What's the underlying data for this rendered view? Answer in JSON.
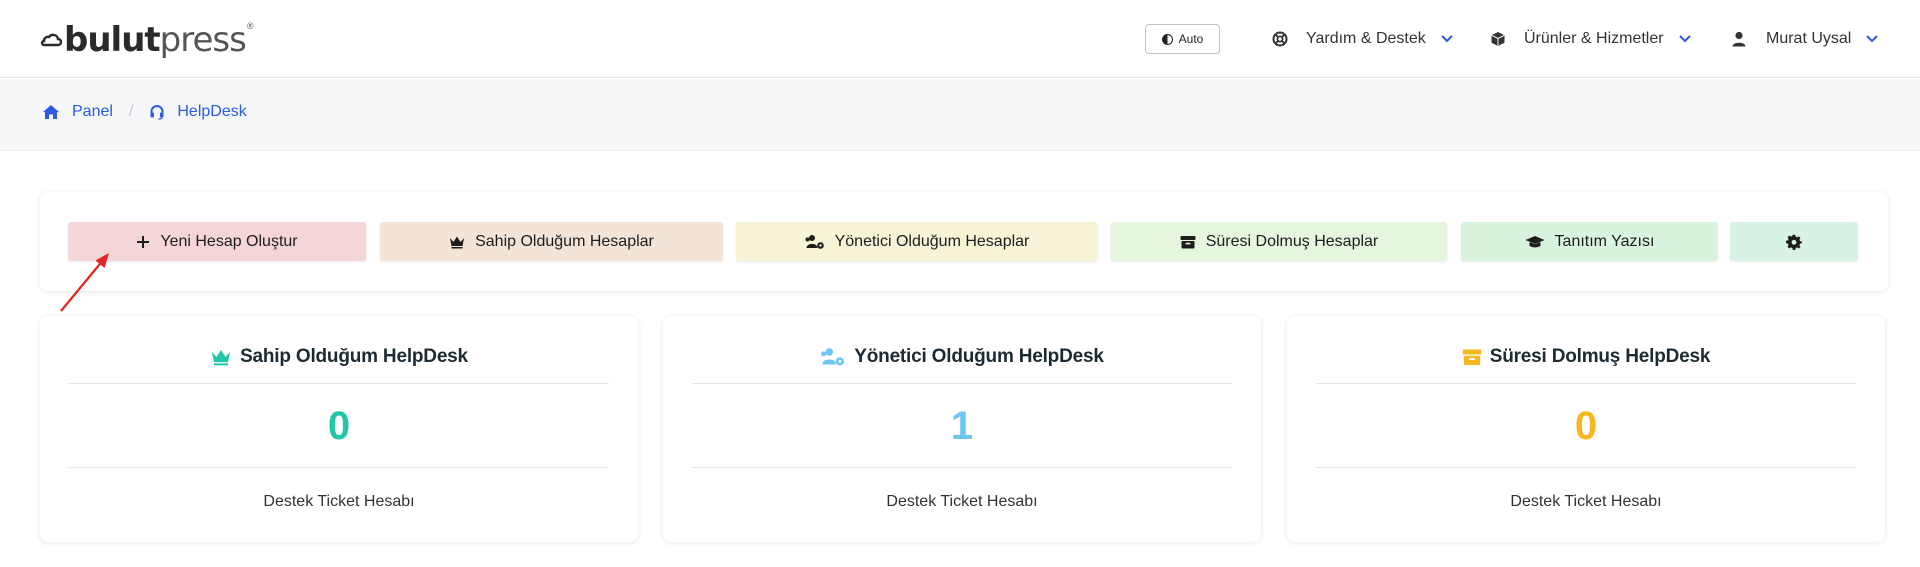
{
  "header": {
    "logo": {
      "main": "bulut",
      "light": "press",
      "reg": "®"
    },
    "theme_button": "Auto",
    "nav": [
      {
        "label": "Yardım & Destek",
        "icon": "lifebuoy-icon"
      },
      {
        "label": "Ürünler & Hizmetler",
        "icon": "cube-icon"
      },
      {
        "label": "Murat Uysal",
        "icon": "user-icon"
      }
    ]
  },
  "breadcrumb": [
    {
      "label": "Panel",
      "icon": "home-icon"
    },
    {
      "label": "HelpDesk",
      "icon": "headset-icon"
    }
  ],
  "actions": [
    {
      "label": "Yeni Hesap Oluştur",
      "icon": "plus-icon",
      "color": "#f5d6d8"
    },
    {
      "label": "Sahip Olduğum Hesaplar",
      "icon": "crown-icon",
      "color": "#f4e4d8"
    },
    {
      "label": "Yönetici Olduğum Hesaplar",
      "icon": "users-gear-icon",
      "color": "#f6f3d6"
    },
    {
      "label": "Süresi Dolmuş Hesaplar",
      "icon": "archive-icon",
      "color": "#e6f5dd"
    },
    {
      "label": "Tanıtım Yazısı",
      "icon": "graduation-cap-icon",
      "color": "#d8f4df"
    },
    {
      "label": "",
      "icon": "gear-icon",
      "color": "#d8f2e5"
    }
  ],
  "cards": [
    {
      "title": "Sahip Olduğum HelpDesk",
      "value": "0",
      "subtitle": "Destek Ticket Hesabı",
      "color": "#1fc7a6",
      "icon": "crown-icon"
    },
    {
      "title": "Yönetici Olduğum HelpDesk",
      "value": "1",
      "subtitle": "Destek Ticket Hesabı",
      "color": "#6cc6ef",
      "icon": "users-gear-icon"
    },
    {
      "title": "Süresi Dolmuş HelpDesk",
      "value": "0",
      "subtitle": "Destek Ticket Hesabı",
      "color": "#f5b821",
      "icon": "archive-icon"
    }
  ],
  "colors": {
    "link": "#2d5be3",
    "nav_chevron": "#2d5be3",
    "annotation": "#e32420"
  }
}
